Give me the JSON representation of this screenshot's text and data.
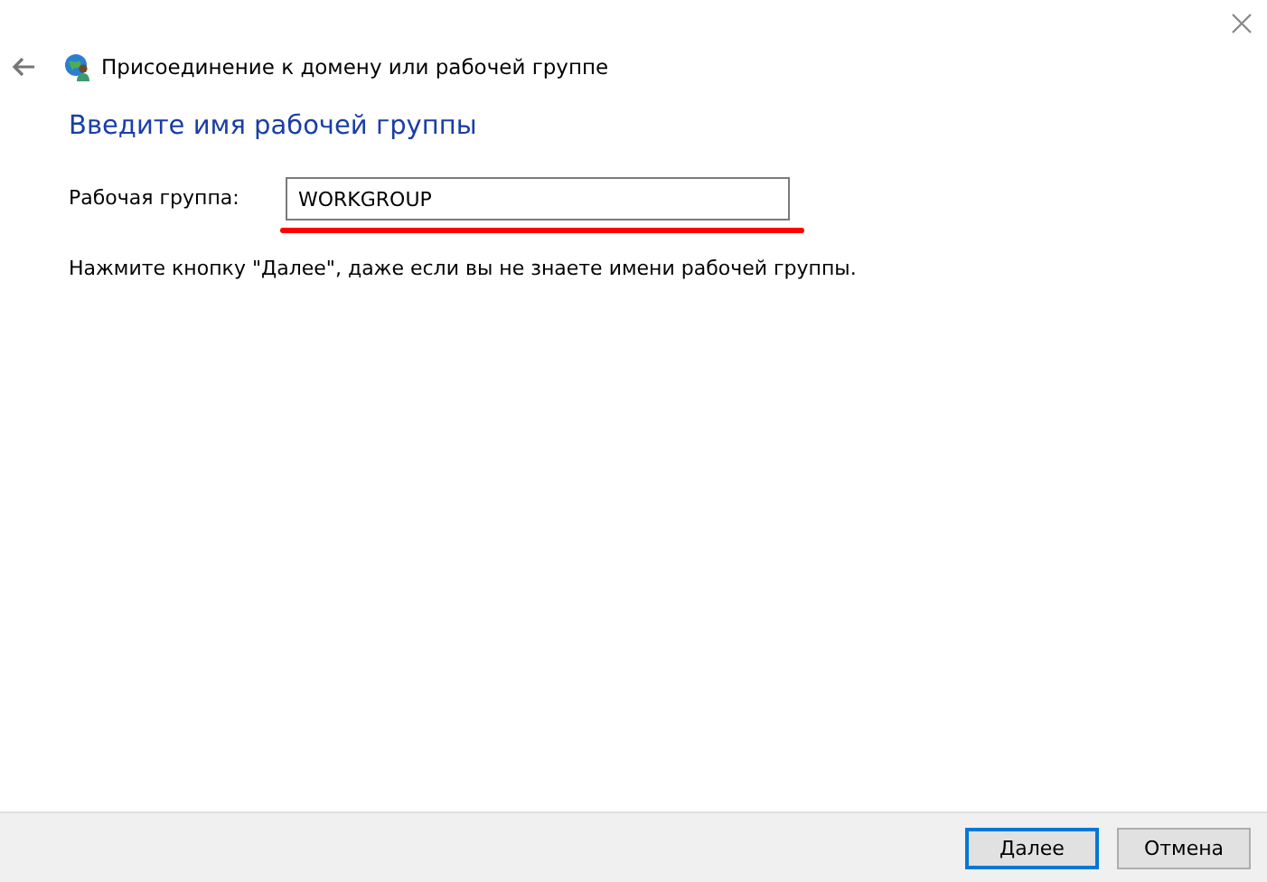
{
  "window": {
    "title": "Присоединение к домену или рабочей группе"
  },
  "heading": "Введите имя рабочей группы",
  "workgroup_field": {
    "label": "Рабочая группа:",
    "value": "WORKGROUP"
  },
  "hint": "Нажмите кнопку \"Далее\", даже если вы не знаете имени рабочей группы.",
  "buttons": [
    {
      "label": "Далее",
      "selected": true
    },
    {
      "label": "Отмена",
      "selected": false
    }
  ]
}
